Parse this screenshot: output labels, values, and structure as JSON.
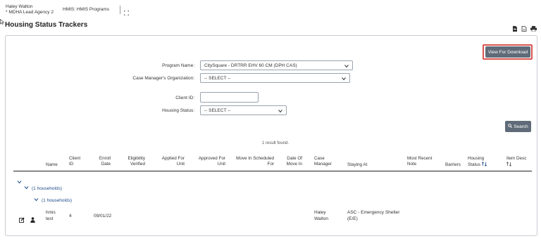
{
  "header": {
    "user_name": "Haley Walton",
    "agency": "* MDHA Lead Agency 2",
    "app_label": "HMIS: HMIS Programs"
  },
  "page": {
    "title": "Housing Status Trackers"
  },
  "download_button": "View For Download",
  "form": {
    "program_name_label": "Program Name:",
    "program_name_value": "CitySquare - DRTRR EHV 60 CM (DPH CAS)",
    "case_manager_org_label": "Case Manager's Organization:",
    "case_manager_org_value": "-- SELECT --",
    "client_id_label": "Client ID:",
    "client_id_value": "",
    "housing_status_label": "Housing Status:",
    "housing_status_value": "-- SELECT --"
  },
  "search_button": "Search",
  "results_text": "1 result found.",
  "table": {
    "headers": {
      "name": "Name",
      "client_id_1": "Client",
      "client_id_2": "ID",
      "enroll_1": "Enroll",
      "enroll_2": "Date",
      "elig_1": "Eligibility",
      "elig_2": "Verified",
      "applied_1": "Applied For",
      "applied_2": "Unit",
      "approved_1": "Approved For",
      "approved_2": "Unit",
      "movein_sched_1": "Move In Scheduled",
      "movein_sched_2": "For",
      "dateof_1": "Date Of",
      "dateof_2": "Move In",
      "case_1": "Case",
      "case_2": "Manager",
      "staying_at": "Staying At",
      "recent_1": "Most Recent",
      "recent_2": "Note",
      "barriers": "Barriers",
      "housing_1": "Housing",
      "housing_2": "Status",
      "item_1": "Item Desc"
    },
    "group_label_1": "(1 households)",
    "group_label_2": "(1 households)",
    "row": {
      "name_1": "hmis",
      "name_2": "test",
      "client_id": "4",
      "enroll_date": "09/01/22",
      "case_manager_1": "Haley",
      "case_manager_2": "Walton",
      "staying_at_1": "ASC - Emergency Shelter",
      "staying_at_2": "(E/E)"
    }
  },
  "icons": {
    "expand": "expand-icon",
    "pdf": "pdf-icon",
    "doc": "document-icon",
    "print": "print-icon",
    "search": "search-icon",
    "edit": "edit-icon",
    "person": "person-icon",
    "sort": "sort-icon",
    "chevron": "chevron-down-icon"
  },
  "colors": {
    "button_bg": "#5f6b78",
    "highlight_border": "#d9534f",
    "link": "#1f4e8c"
  }
}
